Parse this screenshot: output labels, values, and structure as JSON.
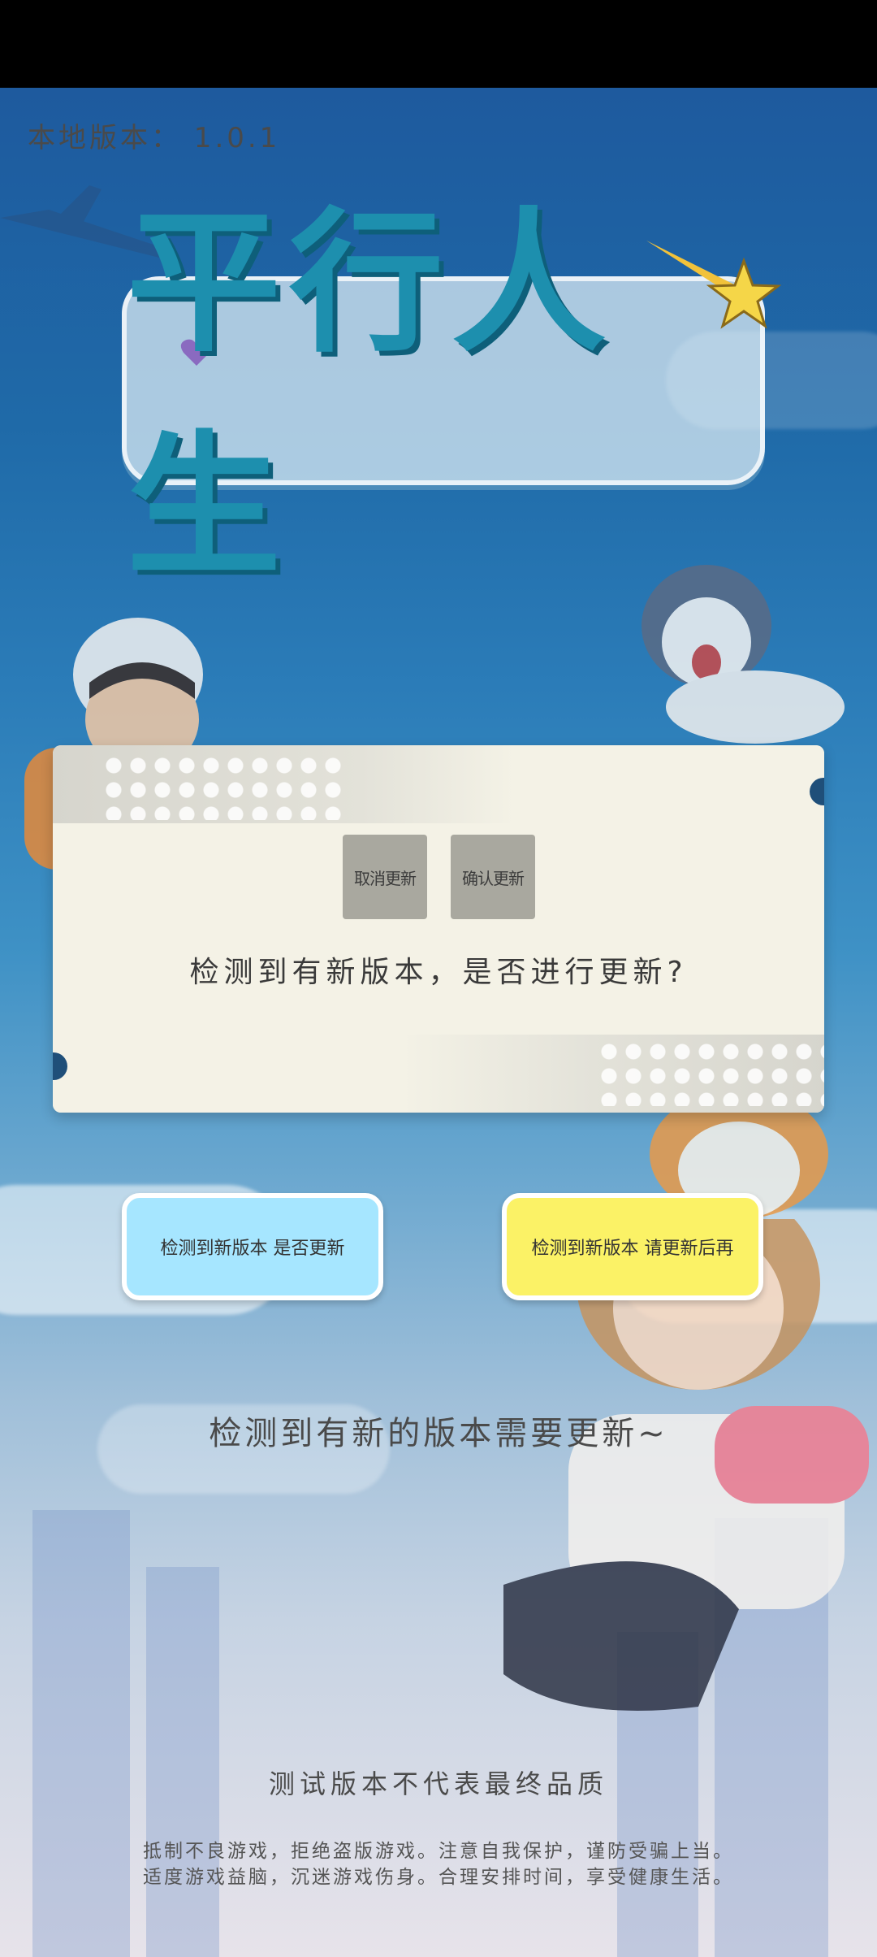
{
  "app": {
    "version_label": "本地版本： 1.0.1",
    "logo_text": "平行人生"
  },
  "dialog": {
    "cancel_label": "取消更新",
    "confirm_label": "确认更新",
    "message": "检测到有新版本，是否进行更新?"
  },
  "buttons": {
    "left_label": "检测到新版本 是否更新",
    "right_label": "检测到新版本 请更新后再"
  },
  "status_text": "检测到有新的版本需要更新~",
  "test_notice": "测试版本不代表最终品质",
  "health_notice": {
    "line1": "抵制不良游戏，拒绝盗版游戏。注意自我保护，谨防受骗上当。",
    "line2": "适度游戏益脑，沉迷游戏伤身。合理安排时间，享受健康生活。"
  },
  "colors": {
    "dialog_bg": "#f4f2e6",
    "left_button": "#a6e6ff",
    "right_button": "#fbf266",
    "logo_text": "#1d8fae"
  }
}
